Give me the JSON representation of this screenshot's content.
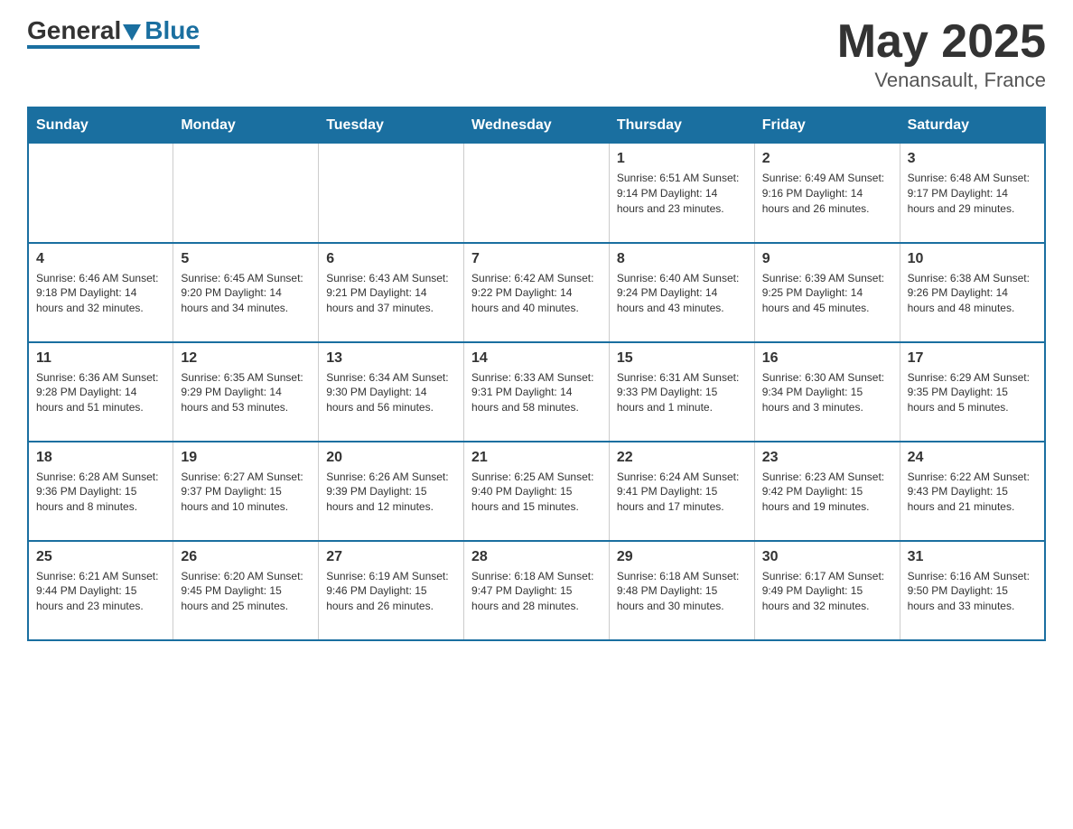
{
  "header": {
    "logo_text_general": "General",
    "logo_text_blue": "Blue",
    "month_year": "May 2025",
    "location": "Venansault, France"
  },
  "weekdays": [
    "Sunday",
    "Monday",
    "Tuesday",
    "Wednesday",
    "Thursday",
    "Friday",
    "Saturday"
  ],
  "weeks": [
    [
      {
        "day": "",
        "info": ""
      },
      {
        "day": "",
        "info": ""
      },
      {
        "day": "",
        "info": ""
      },
      {
        "day": "",
        "info": ""
      },
      {
        "day": "1",
        "info": "Sunrise: 6:51 AM\nSunset: 9:14 PM\nDaylight: 14 hours\nand 23 minutes."
      },
      {
        "day": "2",
        "info": "Sunrise: 6:49 AM\nSunset: 9:16 PM\nDaylight: 14 hours\nand 26 minutes."
      },
      {
        "day": "3",
        "info": "Sunrise: 6:48 AM\nSunset: 9:17 PM\nDaylight: 14 hours\nand 29 minutes."
      }
    ],
    [
      {
        "day": "4",
        "info": "Sunrise: 6:46 AM\nSunset: 9:18 PM\nDaylight: 14 hours\nand 32 minutes."
      },
      {
        "day": "5",
        "info": "Sunrise: 6:45 AM\nSunset: 9:20 PM\nDaylight: 14 hours\nand 34 minutes."
      },
      {
        "day": "6",
        "info": "Sunrise: 6:43 AM\nSunset: 9:21 PM\nDaylight: 14 hours\nand 37 minutes."
      },
      {
        "day": "7",
        "info": "Sunrise: 6:42 AM\nSunset: 9:22 PM\nDaylight: 14 hours\nand 40 minutes."
      },
      {
        "day": "8",
        "info": "Sunrise: 6:40 AM\nSunset: 9:24 PM\nDaylight: 14 hours\nand 43 minutes."
      },
      {
        "day": "9",
        "info": "Sunrise: 6:39 AM\nSunset: 9:25 PM\nDaylight: 14 hours\nand 45 minutes."
      },
      {
        "day": "10",
        "info": "Sunrise: 6:38 AM\nSunset: 9:26 PM\nDaylight: 14 hours\nand 48 minutes."
      }
    ],
    [
      {
        "day": "11",
        "info": "Sunrise: 6:36 AM\nSunset: 9:28 PM\nDaylight: 14 hours\nand 51 minutes."
      },
      {
        "day": "12",
        "info": "Sunrise: 6:35 AM\nSunset: 9:29 PM\nDaylight: 14 hours\nand 53 minutes."
      },
      {
        "day": "13",
        "info": "Sunrise: 6:34 AM\nSunset: 9:30 PM\nDaylight: 14 hours\nand 56 minutes."
      },
      {
        "day": "14",
        "info": "Sunrise: 6:33 AM\nSunset: 9:31 PM\nDaylight: 14 hours\nand 58 minutes."
      },
      {
        "day": "15",
        "info": "Sunrise: 6:31 AM\nSunset: 9:33 PM\nDaylight: 15 hours\nand 1 minute."
      },
      {
        "day": "16",
        "info": "Sunrise: 6:30 AM\nSunset: 9:34 PM\nDaylight: 15 hours\nand 3 minutes."
      },
      {
        "day": "17",
        "info": "Sunrise: 6:29 AM\nSunset: 9:35 PM\nDaylight: 15 hours\nand 5 minutes."
      }
    ],
    [
      {
        "day": "18",
        "info": "Sunrise: 6:28 AM\nSunset: 9:36 PM\nDaylight: 15 hours\nand 8 minutes."
      },
      {
        "day": "19",
        "info": "Sunrise: 6:27 AM\nSunset: 9:37 PM\nDaylight: 15 hours\nand 10 minutes."
      },
      {
        "day": "20",
        "info": "Sunrise: 6:26 AM\nSunset: 9:39 PM\nDaylight: 15 hours\nand 12 minutes."
      },
      {
        "day": "21",
        "info": "Sunrise: 6:25 AM\nSunset: 9:40 PM\nDaylight: 15 hours\nand 15 minutes."
      },
      {
        "day": "22",
        "info": "Sunrise: 6:24 AM\nSunset: 9:41 PM\nDaylight: 15 hours\nand 17 minutes."
      },
      {
        "day": "23",
        "info": "Sunrise: 6:23 AM\nSunset: 9:42 PM\nDaylight: 15 hours\nand 19 minutes."
      },
      {
        "day": "24",
        "info": "Sunrise: 6:22 AM\nSunset: 9:43 PM\nDaylight: 15 hours\nand 21 minutes."
      }
    ],
    [
      {
        "day": "25",
        "info": "Sunrise: 6:21 AM\nSunset: 9:44 PM\nDaylight: 15 hours\nand 23 minutes."
      },
      {
        "day": "26",
        "info": "Sunrise: 6:20 AM\nSunset: 9:45 PM\nDaylight: 15 hours\nand 25 minutes."
      },
      {
        "day": "27",
        "info": "Sunrise: 6:19 AM\nSunset: 9:46 PM\nDaylight: 15 hours\nand 26 minutes."
      },
      {
        "day": "28",
        "info": "Sunrise: 6:18 AM\nSunset: 9:47 PM\nDaylight: 15 hours\nand 28 minutes."
      },
      {
        "day": "29",
        "info": "Sunrise: 6:18 AM\nSunset: 9:48 PM\nDaylight: 15 hours\nand 30 minutes."
      },
      {
        "day": "30",
        "info": "Sunrise: 6:17 AM\nSunset: 9:49 PM\nDaylight: 15 hours\nand 32 minutes."
      },
      {
        "day": "31",
        "info": "Sunrise: 6:16 AM\nSunset: 9:50 PM\nDaylight: 15 hours\nand 33 minutes."
      }
    ]
  ]
}
